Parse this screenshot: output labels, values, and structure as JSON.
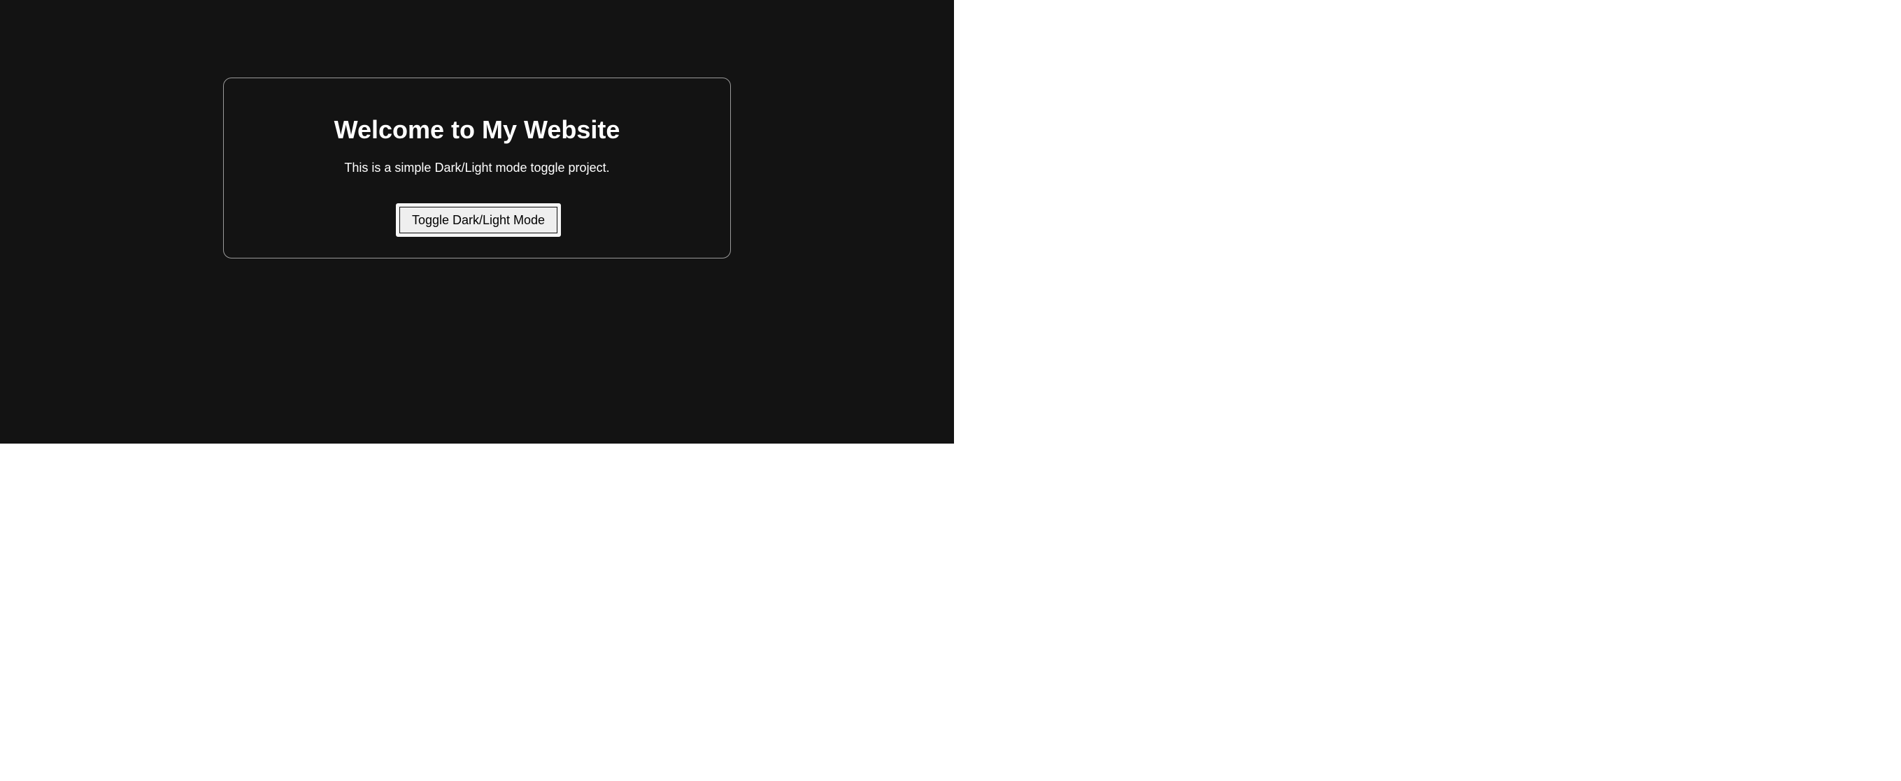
{
  "page": {
    "background_color": "#131313",
    "text_color": "#ffffff"
  },
  "card": {
    "title": "Welcome to My Website",
    "subtitle": "This is a simple Dark/Light mode toggle project.",
    "border_color": "#9a9a9a"
  },
  "toggle": {
    "label": "Toggle Dark/Light Mode",
    "background_color": "#efefef"
  }
}
